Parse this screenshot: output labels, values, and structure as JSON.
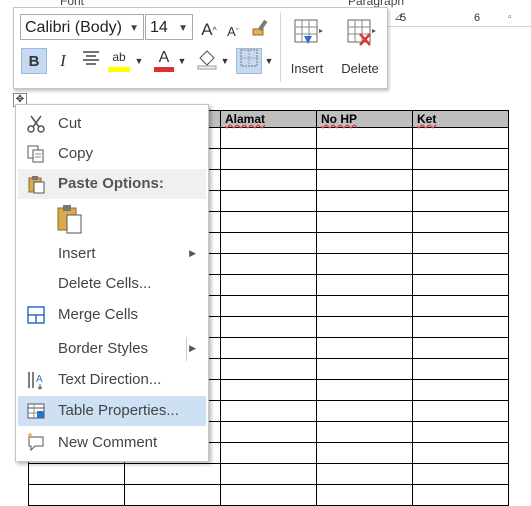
{
  "ribbon": {
    "font_group_label": "Font",
    "paragraph_group_label": "Paragraph",
    "ruler_left": "5",
    "ruler_right": "6"
  },
  "mini_toolbar": {
    "font_name": "Calibri (Body)",
    "font_size": "14",
    "grow_font_glyph": "A",
    "shrink_font_glyph": "A",
    "bold_glyph": "B",
    "italic_glyph": "I",
    "highlight_glyph": "ab",
    "font_color_glyph": "A",
    "insert_label": "Insert",
    "delete_label": "Delete",
    "highlight_color": "#ffff00",
    "font_color": "#e03030"
  },
  "table": {
    "headers": [
      "",
      "",
      "Alamat",
      "No HP",
      "Ket"
    ],
    "row_count": 18,
    "header_bg": "#bfbfbf"
  },
  "context_menu": {
    "items": [
      {
        "label": "Cut",
        "icon": "scissors-icon"
      },
      {
        "label": "Copy",
        "icon": "copy-icon"
      },
      {
        "label": "Paste Options:",
        "icon": "paste-icon"
      },
      {
        "label": "Insert",
        "icon": ""
      },
      {
        "label": "Delete Cells...",
        "icon": ""
      },
      {
        "label": "Merge Cells",
        "icon": "merge-cells-icon"
      },
      {
        "label": "Border Styles",
        "icon": ""
      },
      {
        "label": "Text Direction...",
        "icon": "text-direction-icon"
      },
      {
        "label": "Table Properties...",
        "icon": "table-properties-icon"
      },
      {
        "label": "New Comment",
        "icon": "new-comment-icon"
      }
    ],
    "highlight_color": "#cde0f4"
  }
}
